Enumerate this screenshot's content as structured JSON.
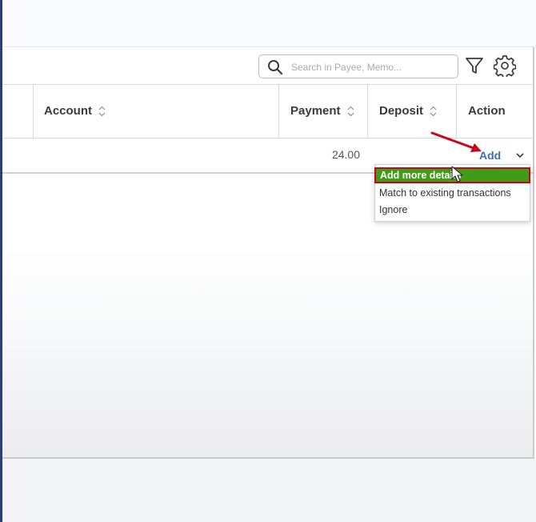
{
  "search": {
    "placeholder": "Search in Payee, Memo..."
  },
  "table": {
    "headers": {
      "account": "Account",
      "payment": "Payment",
      "deposit": "Deposit",
      "action": "Action"
    },
    "row": {
      "payment": "24.00",
      "action_label": "Add"
    }
  },
  "action_menu": {
    "items": [
      "Add more details",
      "Match to existing transactions",
      "Ignore"
    ],
    "highlighted_index": 0
  },
  "colors": {
    "highlight_bg": "#3e9c18",
    "highlight_border": "#d0021b",
    "link": "#3f6fb0",
    "annotation_arrow": "#d0021b"
  },
  "icons": [
    "search-icon",
    "filter-icon",
    "gear-icon",
    "sort-icon",
    "chevron-down-icon",
    "mouse-cursor-icon",
    "annotation-arrow"
  ]
}
